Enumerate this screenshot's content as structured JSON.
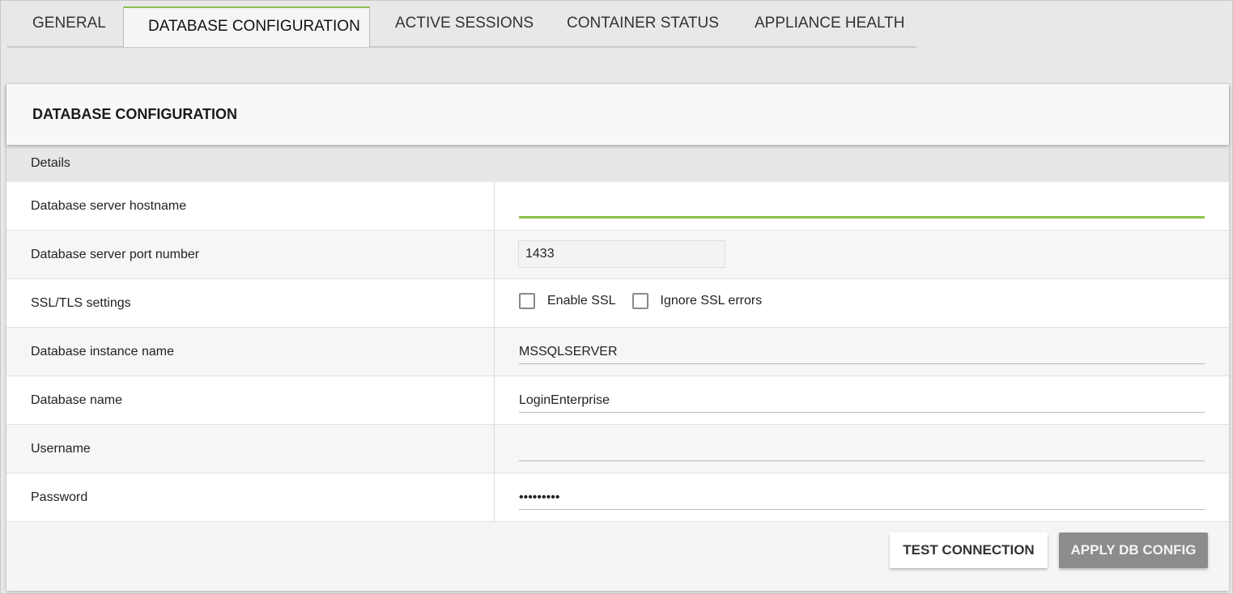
{
  "tabs": [
    {
      "label": "GENERAL"
    },
    {
      "label": "DATABASE CONFIGURATION"
    },
    {
      "label": "ACTIVE SESSIONS"
    },
    {
      "label": "CONTAINER STATUS"
    },
    {
      "label": "APPLIANCE HEALTH"
    }
  ],
  "active_tab_color": "#8cc04a",
  "panel": {
    "title": "DATABASE CONFIGURATION",
    "section": "Details",
    "fields": {
      "hostname": {
        "label": "Database server hostname",
        "value": ""
      },
      "port": {
        "label": "Database server port number",
        "value": "1433"
      },
      "ssl": {
        "label": "SSL/TLS settings",
        "enable_ssl": "Enable SSL",
        "ignore_errors": "Ignore SSL errors"
      },
      "instance": {
        "label": "Database instance name",
        "value": "MSSQLSERVER"
      },
      "dbname": {
        "label": "Database name",
        "value": "LoginEnterprise"
      },
      "username": {
        "label": "Username",
        "value": ""
      },
      "password": {
        "label": "Password",
        "value": "•••••••••"
      }
    }
  },
  "buttons": {
    "test": "TEST CONNECTION",
    "apply": "APPLY DB CONFIG"
  }
}
